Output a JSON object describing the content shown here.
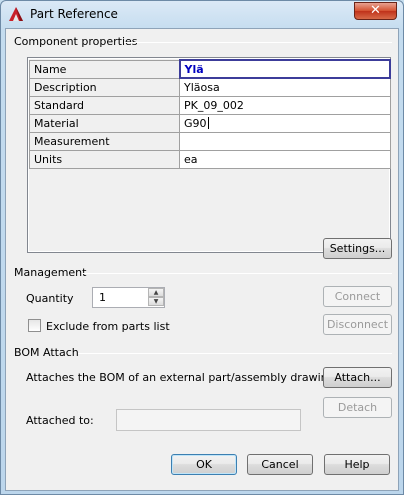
{
  "window": {
    "title": "Part Reference",
    "close_glyph": "✕",
    "icon": "autocad-a-icon"
  },
  "component_properties": {
    "group_label": "Component properties",
    "rows": [
      {
        "name": "Name",
        "value": "Ylä"
      },
      {
        "name": "Description",
        "value": "Yläosa"
      },
      {
        "name": "Standard",
        "value": "PK_09_002"
      },
      {
        "name": "Material",
        "value": "G90"
      },
      {
        "name": "Measurement",
        "value": ""
      },
      {
        "name": "Units",
        "value": "ea"
      }
    ],
    "settings_label": "Settings..."
  },
  "management": {
    "group_label": "Management",
    "quantity_label": "Quantity",
    "quantity_value": "1",
    "exclude_label": "Exclude from parts list",
    "exclude_checked": false,
    "connect_label": "Connect",
    "disconnect_label": "Disconnect"
  },
  "bom_attach": {
    "group_label": "BOM Attach",
    "description": "Attaches the BOM of an external part/assembly drawing",
    "attach_label": "Attach...",
    "detach_label": "Detach",
    "attached_to_label": "Attached to:",
    "attached_to_value": ""
  },
  "footer": {
    "ok_label": "OK",
    "cancel_label": "Cancel",
    "help_label": "Help"
  },
  "colors": {
    "selected_value": "#0000c0",
    "close_button": "#c0321a"
  }
}
